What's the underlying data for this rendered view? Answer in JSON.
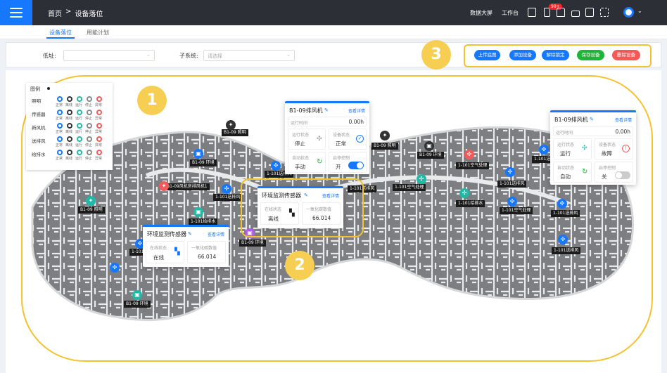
{
  "topbar": {
    "breadcrumb": [
      "首页",
      ">",
      "设备落位"
    ],
    "links": [
      "数据大屏",
      "工作台"
    ],
    "badge": "99+"
  },
  "tabs": [
    "设备落位",
    "用能计划"
  ],
  "filters": {
    "floor_label": "低址:",
    "floor_value": "",
    "subsystem_label": "子系统:",
    "subsystem_placeholder": "请选择"
  },
  "actions": [
    {
      "label": "上传底图",
      "color": "#1677ff"
    },
    {
      "label": "添加设备",
      "color": "#1677ff"
    },
    {
      "label": "解除锁定",
      "color": "#1677ff"
    },
    {
      "label": "保存设备",
      "color": "#21b33a"
    },
    {
      "label": "删除设备",
      "color": "#f25a5a"
    }
  ],
  "annotations": [
    "1",
    "2",
    "3"
  ],
  "legend": {
    "title": "图例",
    "rows": [
      "照明",
      "传感器",
      "新风机",
      "送排风",
      "给排水"
    ],
    "status": [
      "正常",
      "离线",
      "运行",
      "停止",
      "异常"
    ],
    "colors": [
      "#1677ff",
      "#333333",
      "#1fb9a5",
      "#888888",
      "#f25a5a"
    ]
  },
  "map_labels": [
    "B1-09 照明",
    "B1-09 环境",
    "1-101送排风",
    "B1-09风机房排风机1",
    "B1-09 照明",
    "1-101送排风",
    "1-101给排水",
    "B1-09 环境",
    "1-101送排风",
    "B1-09 环境",
    "B1-09 照明",
    "B1-09 环境",
    "1-101空气处理",
    "1-101送排风",
    "1-101送排风",
    "1-101空气处理",
    "1-101给排水",
    "1-101空气处理",
    "1-101送排风",
    "1-101送排风",
    "1-101送排风"
  ],
  "cards": {
    "fan_a": {
      "title": "B1-09排风机",
      "link": "查看详情",
      "runtime_label": "运行时间",
      "runtime": "0.00h",
      "run_label": "运行状态",
      "run": "停止",
      "dev_label": "设备状态",
      "dev": "正常",
      "auto_label": "自动状态",
      "auto": "手动",
      "ctrl_label": "启停控制",
      "ctrl": "开"
    },
    "fan_b": {
      "title": "B1-09排风机",
      "link": "查看详情",
      "runtime_label": "运行时间",
      "runtime": "0.00h",
      "run_label": "运行状态",
      "run": "运行",
      "dev_label": "设备状态",
      "dev": "故障",
      "auto_label": "自动状态",
      "auto": "自动",
      "ctrl_label": "启停控制",
      "ctrl": "关"
    },
    "env_a": {
      "title": "环境监测传感器",
      "link": "查看详情",
      "online_label": "在线状态",
      "online": "离线",
      "co_label": "一氧化碳数值",
      "co": "66.014"
    },
    "env_b": {
      "title": "环境监测传感器",
      "link": "查看详情",
      "online_label": "在线状态",
      "online": "在线",
      "co_label": "一氧化碳数值",
      "co": "66.014"
    }
  }
}
